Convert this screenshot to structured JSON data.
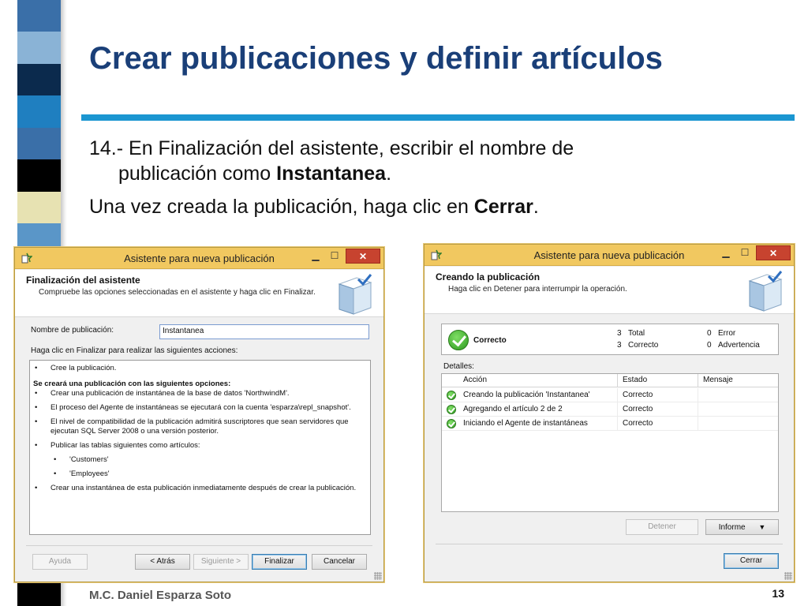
{
  "slide": {
    "title": "Crear publicaciones y definir artículos",
    "step_line1": "14.- En Finalización del asistente, escribir el nombre de",
    "step_line2_pre": "publicación como ",
    "step_line2_bold": "Instantanea",
    "step_line2_post": ".",
    "para2_pre": "Una vez creada la publicación, haga clic en ",
    "para2_bold": "Cerrar",
    "para2_post": ".",
    "author": "M.C. Daniel Esparza Soto",
    "page_number": "13",
    "stripe_colors": [
      "#3a6fa8",
      "#8ab3d6",
      "#0b2a4d",
      "#1f7fc0",
      "#3a6fa8",
      "#000000",
      "#e7e2b2",
      "#5a96c8",
      "#d8d8c0",
      "#1d4f86",
      "#0b2a4d",
      "#7fb0d8",
      "#1f7fc0",
      "#8ab3d6",
      "#2f6aa8",
      "#0b2a4d",
      "#3a6fa8",
      "#5a96c8",
      "#000000"
    ]
  },
  "dialog1": {
    "window_title": "Asistente para nueva publicación",
    "header_title": "Finalización del asistente",
    "header_subtitle": "Compruebe las opciones seleccionadas en el asistente y haga clic en Finalizar.",
    "name_label": "Nombre de publicación:",
    "name_value": "Instantanea",
    "actions_label": "Haga clic en Finalizar para realizar las siguientes acciones:",
    "summary": {
      "item_create": "Cree la publicación.",
      "options_heading": "Se creará una publicación con las siguientes opciones:",
      "item_snapshot_db": "Crear una publicación de instantánea de la base de datos 'NorthwindM'.",
      "item_agent_account": "El proceso del Agente de instantáneas se ejecutará con la cuenta 'esparza\\repl_snapshot'.",
      "item_compat": "El nivel de compatibilidad de la publicación admitirá suscriptores que sean servidores que ejecutan SQL Server 2008 o una versión posterior.",
      "item_publish_tables": "Publicar las tablas siguientes como artículos:",
      "table_customers": "'Customers'",
      "table_employees": "'Employees'",
      "item_create_snapshot": "Crear una instantánea de esta publicación inmediatamente después de crear la publicación."
    },
    "buttons": {
      "help": "Ayuda",
      "back": "< Atrás",
      "next": "Siguiente >",
      "finish": "Finalizar",
      "cancel": "Cancelar"
    }
  },
  "dialog2": {
    "window_title": "Asistente para nueva publicación",
    "header_title": "Creando la publicación",
    "header_subtitle": "Haga clic en Detener para interrumpir la operación.",
    "status": {
      "label": "Correcto",
      "total_count": "3",
      "total_label": "Total",
      "success_count": "3",
      "success_label": "Correcto",
      "error_count": "0",
      "error_label": "Error",
      "warning_count": "0",
      "warning_label": "Advertencia"
    },
    "details_label": "Detalles:",
    "columns": {
      "action": "Acción",
      "state": "Estado",
      "message": "Mensaje"
    },
    "rows": [
      {
        "action": "Creando la publicación 'Instantanea'",
        "state": "Correcto",
        "message": ""
      },
      {
        "action": "Agregando el artículo 2 de 2",
        "state": "Correcto",
        "message": ""
      },
      {
        "action": "Iniciando el Agente de instantáneas",
        "state": "Correcto",
        "message": ""
      }
    ],
    "buttons": {
      "stop": "Detener",
      "report": "Informe",
      "close": "Cerrar"
    }
  }
}
